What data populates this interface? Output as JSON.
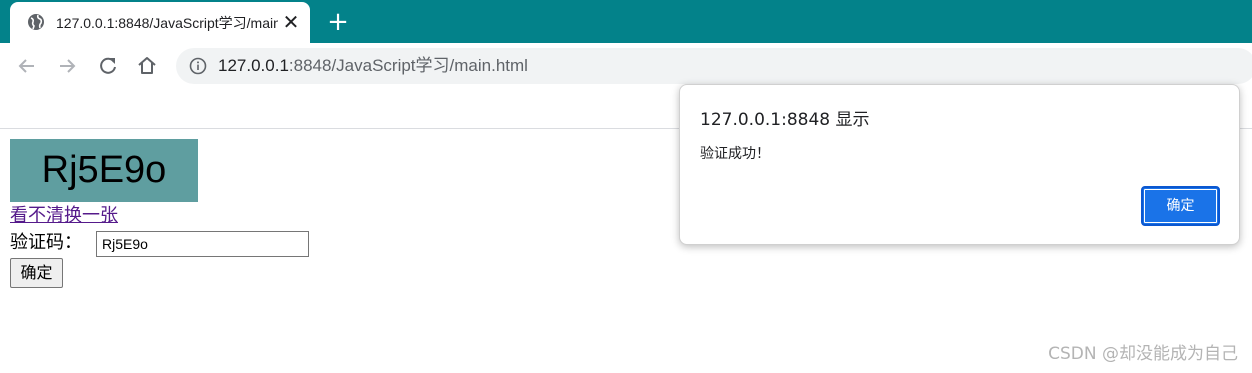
{
  "browser": {
    "tab": {
      "title": "127.0.0.1:8848/JavaScript学习/main.html",
      "close_glyph": "✕",
      "icon": "globe-icon"
    },
    "new_tab_glyph": "+",
    "address": {
      "host": "127.0.0.1",
      "rest": ":8848/JavaScript学习/main.html",
      "icon": "info-icon"
    },
    "colors": {
      "tabstrip": "#03828a"
    }
  },
  "page": {
    "captcha_text": "Rj5E9o",
    "refresh_link": "看不清换一张",
    "code_label": "验证码：",
    "code_value": "Rj5E9o",
    "confirm_label": "确定"
  },
  "dialog": {
    "origin": "127.0.0.1:8848 显示",
    "message": "验证成功！",
    "ok_label": "确定",
    "accent": "#1a73e8"
  },
  "watermark": "CSDN @却没能成为自己"
}
